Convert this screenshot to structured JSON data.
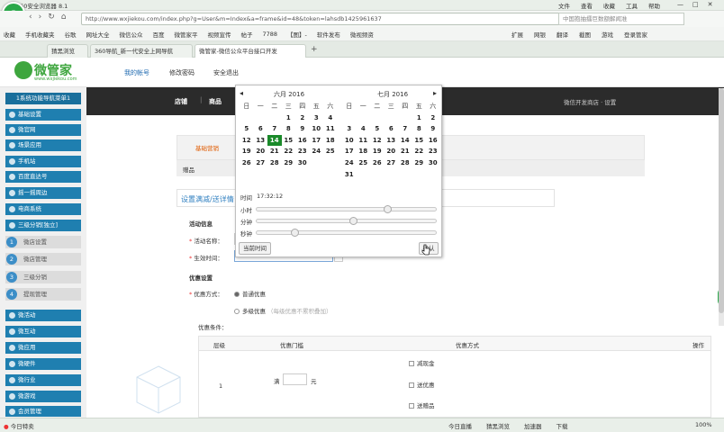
{
  "browser": {
    "title": "360安全浏览器 8.1",
    "menu": [
      "文件",
      "查看",
      "收藏",
      "工具",
      "帮助"
    ],
    "url": "http://www.wxjiekou.com/index.php?g=User&m=Index&a=frame&id=48&token=lahsdb1425961637",
    "search_placeholder": "中国抱抽擂巨数额解闻准",
    "favorites": [
      "收藏",
      "手机收藏夹",
      "谷歌",
      "网址大全",
      "微信公众",
      "百度",
      "微管家平",
      "视频宣传",
      "帖子",
      "7788",
      "【图】-",
      "软件发布",
      "微视频资"
    ],
    "fav_right": [
      "扩展",
      "网银",
      "翻译",
      "截图",
      "游戏",
      "登录管家"
    ],
    "tabs": [
      {
        "label": "猜黑浏览"
      },
      {
        "label": "360导航_新一代安全上网导航"
      },
      {
        "label": "微管家-微信公众平台接口开发"
      }
    ],
    "status": {
      "left": "今日特卖",
      "items": [
        "今日直播",
        "猜黑浏览",
        "加速器",
        "下载"
      ],
      "zoom": "100%"
    }
  },
  "site": {
    "logo_text": "微管家",
    "logo_sub": "www.wxjiekou.com",
    "nav": [
      "我的帐号",
      "修改密码",
      "安全退出"
    ]
  },
  "darkbar": {
    "items": [
      "店铺",
      "商品"
    ],
    "right": "微信开发商店 · 设置"
  },
  "sidebar": {
    "header": "1系统功能导航菜单1",
    "items_top": [
      "基础设置",
      "微官网",
      "场景应用",
      "手机站",
      "百度直达号",
      "摇一摇周边",
      "电商系统",
      "三级分销[独立]"
    ],
    "steps": [
      {
        "num": "1",
        "label": "微店设置"
      },
      {
        "num": "2",
        "label": "微店管理"
      },
      {
        "num": "3",
        "label": "三级分销"
      },
      {
        "num": "4",
        "label": "提现管理"
      }
    ],
    "items_bottom": [
      "微活动",
      "微互动",
      "微应用",
      "微硬件",
      "微行业",
      "微游戏",
      "会员管理"
    ]
  },
  "form": {
    "tab": "基础营销",
    "tab_row_label": "赠品",
    "section_title": "设置满减/送详情",
    "activity_info": "活动信息",
    "name_label": "活动名称：",
    "time_label": "生效时间：",
    "time_value": "2016-06-14 17:32:12",
    "offer_title": "优惠设置",
    "offer_mode_label": "优惠方式：",
    "mode_normal": "普通优惠",
    "mode_multi": "多级优惠",
    "mode_multi_hint": "（每级优惠不累积叠加）",
    "condition_label": "优惠条件：",
    "table_headers": [
      "层级",
      "优惠门槛",
      "优惠方式",
      "操作"
    ],
    "row_level": "1",
    "threshold_prefix": "满",
    "threshold_suffix": "元",
    "options": [
      "减现金",
      "送优惠",
      "送赠品"
    ]
  },
  "calendar": {
    "left_month": "六月 2016",
    "right_month": "七月 2016",
    "weekdays": [
      "日",
      "一",
      "二",
      "三",
      "四",
      "五",
      "六"
    ],
    "left_days": [
      "",
      "",
      "",
      "1",
      "2",
      "3",
      "4",
      "5",
      "6",
      "7",
      "8",
      "9",
      "10",
      "11",
      "12",
      "13",
      "14",
      "15",
      "16",
      "17",
      "18",
      "19",
      "20",
      "21",
      "22",
      "23",
      "24",
      "25",
      "26",
      "27",
      "28",
      "29",
      "30",
      "",
      ""
    ],
    "selected_day": "14",
    "right_days": [
      "",
      "",
      "",
      "",
      "",
      "1",
      "2",
      "3",
      "4",
      "5",
      "6",
      "7",
      "8",
      "9",
      "10",
      "11",
      "12",
      "13",
      "14",
      "15",
      "16",
      "17",
      "18",
      "19",
      "20",
      "21",
      "22",
      "23",
      "24",
      "25",
      "26",
      "27",
      "28",
      "29",
      "30",
      "31"
    ],
    "time_label": "时间",
    "time_value": "17:32:12",
    "hour_label": "小时",
    "minute_label": "分钟",
    "second_label": "秒钟",
    "hour_level": 0.74,
    "minute_level": 0.54,
    "second_level": 0.2,
    "now_button": "当前时间",
    "ok_button": "确认"
  }
}
